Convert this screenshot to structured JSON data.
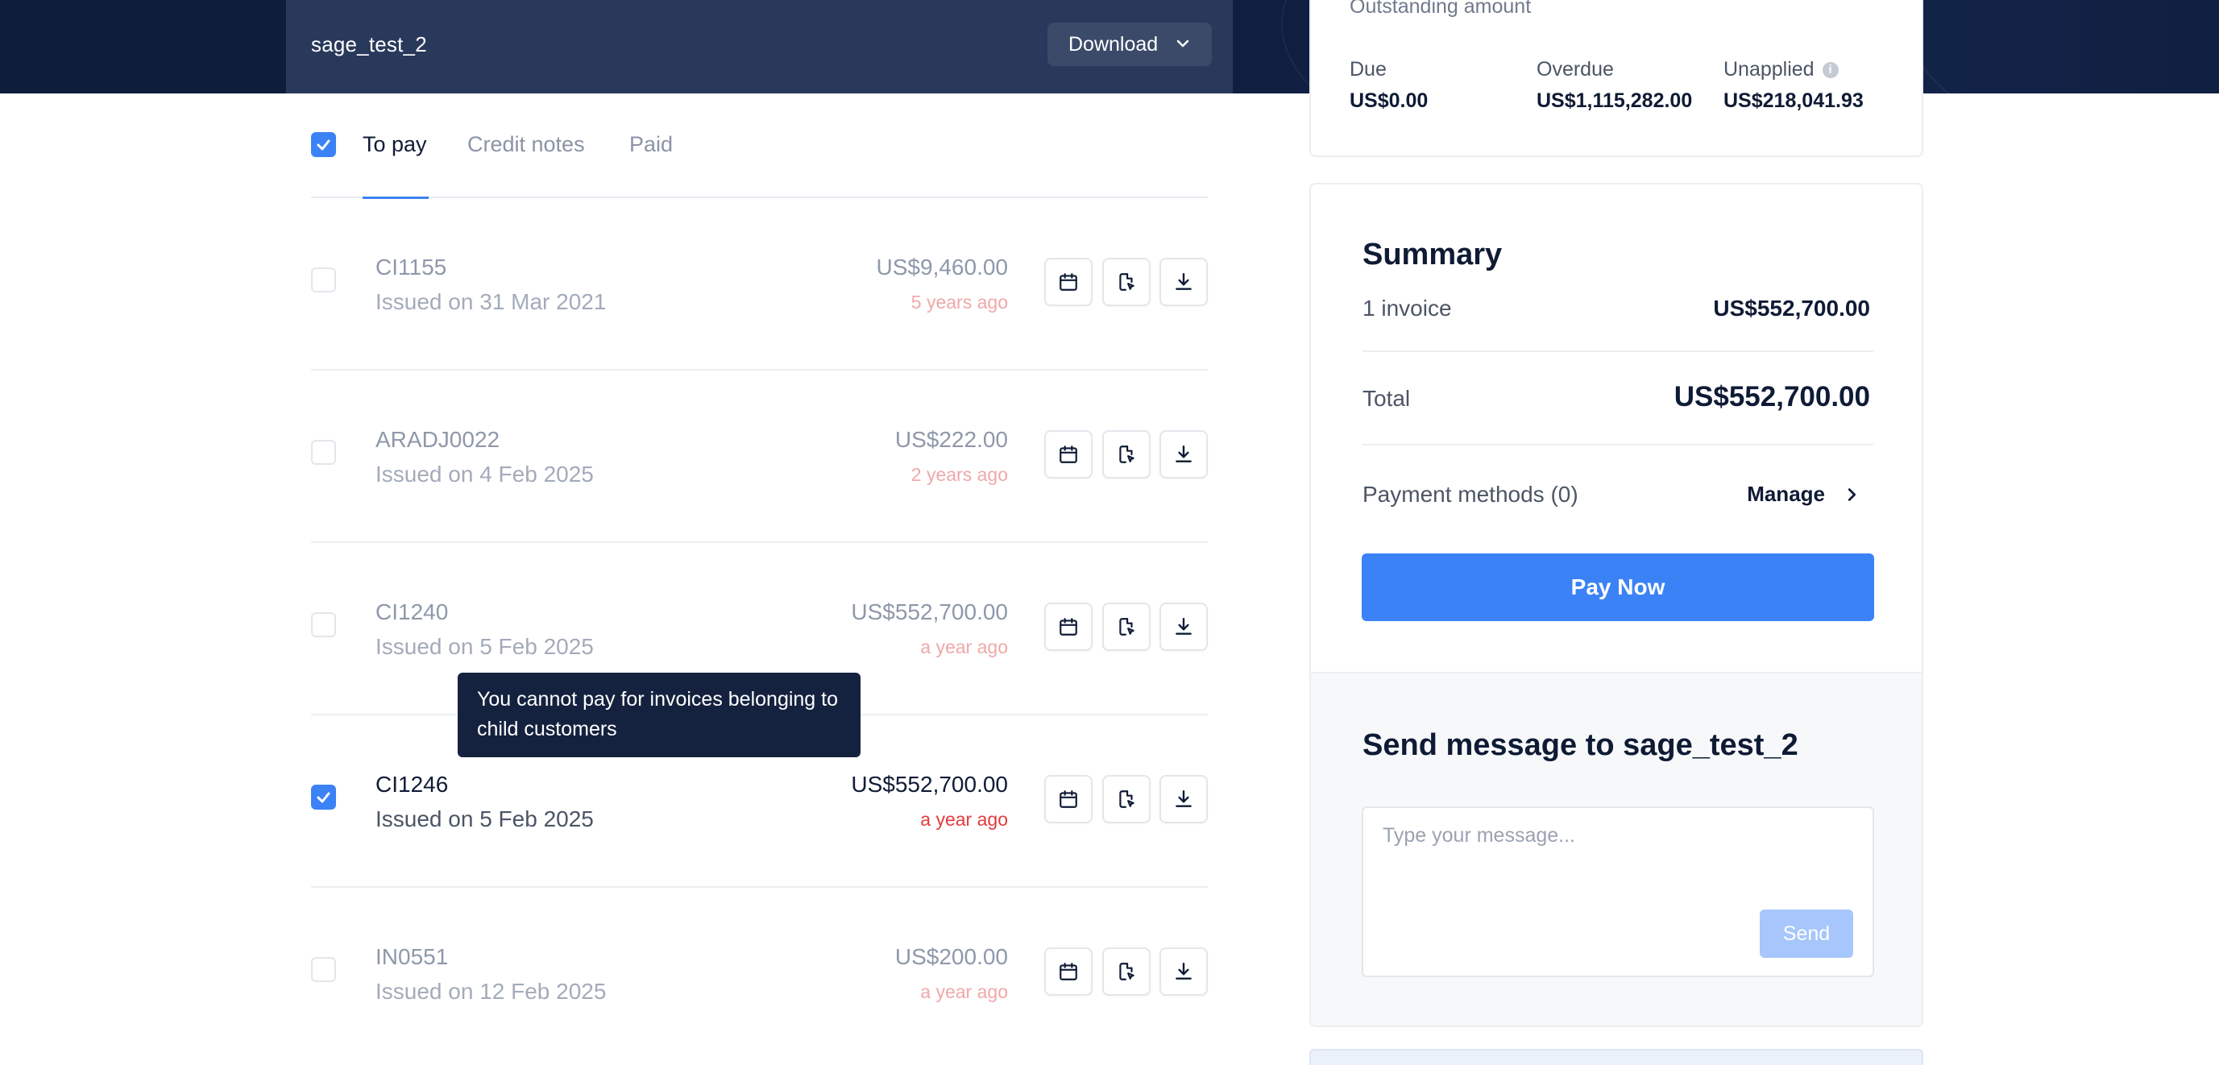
{
  "header": {
    "title": "sage_test_2",
    "download_label": "Download"
  },
  "tabs": [
    {
      "label": "To pay",
      "active": true
    },
    {
      "label": "Credit notes",
      "active": false
    },
    {
      "label": "Paid",
      "active": false
    }
  ],
  "invoices": [
    {
      "id": "CI1155",
      "issued": "Issued on 31 Mar 2021",
      "amount": "US$9,460.00",
      "age": "5 years ago",
      "selected": false
    },
    {
      "id": "ARADJ0022",
      "issued": "Issued on 4 Feb 2025",
      "amount": "US$222.00",
      "age": "2 years ago",
      "selected": false
    },
    {
      "id": "CI1240",
      "issued": "Issued on 5 Feb 2025",
      "amount": "US$552,700.00",
      "age": "a year ago",
      "selected": false
    },
    {
      "id": "CI1246",
      "issued": "Issued on 5 Feb 2025",
      "amount": "US$552,700.00",
      "age": "a year ago",
      "selected": true
    },
    {
      "id": "IN0551",
      "issued": "Issued on 12 Feb 2025",
      "amount": "US$200.00",
      "age": "a year ago",
      "selected": false
    }
  ],
  "tooltip": {
    "text": "You cannot pay for invoices belonging to child customers"
  },
  "outstanding": {
    "title": "Outstanding amount",
    "due_label": "Due",
    "due_value": "US$0.00",
    "overdue_label": "Overdue",
    "overdue_value": "US$1,115,282.00",
    "unapplied_label": "Unapplied",
    "unapplied_value": "US$218,041.93"
  },
  "summary": {
    "title": "Summary",
    "invoice_count_label": "1 invoice",
    "invoice_count_value": "US$552,700.00",
    "total_label": "Total",
    "total_value": "US$552,700.00",
    "payment_methods_label": "Payment methods (0)",
    "manage_label": "Manage",
    "pay_now_label": "Pay Now"
  },
  "message": {
    "title": "Send message to sage_test_2",
    "placeholder": "Type your message...",
    "send_label": "Send"
  },
  "colors": {
    "accent": "#3b82f6",
    "header_dark": "#101f40",
    "overdue_red": "#e23b3b"
  }
}
